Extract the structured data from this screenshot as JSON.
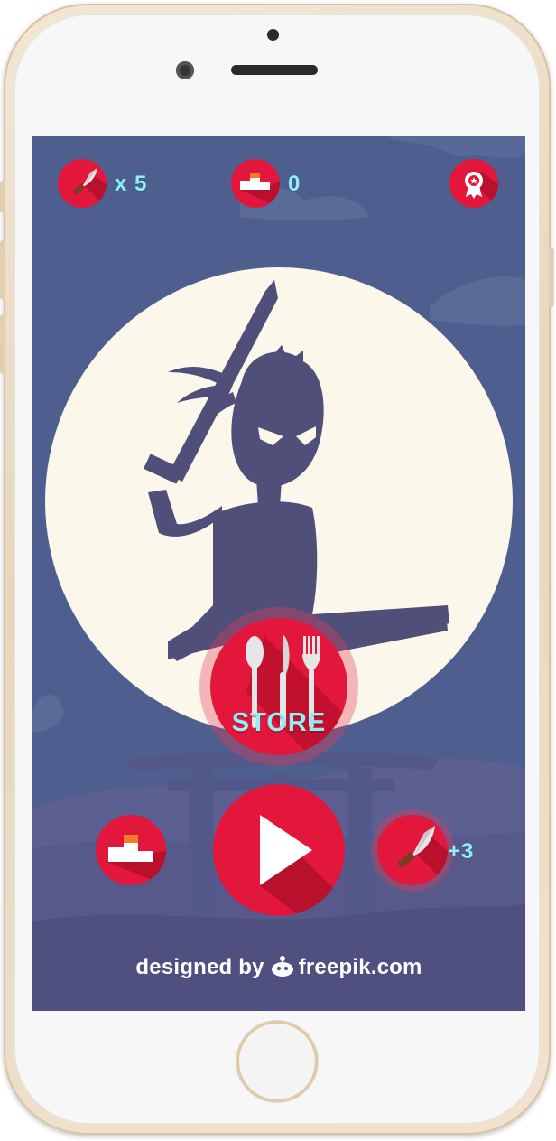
{
  "hud": {
    "knives_count": "x 5",
    "score": "0"
  },
  "buttons": {
    "store_label": "STORE",
    "knife_bonus": "+3"
  },
  "footer": {
    "designed_by": "designed by",
    "brand": "freepik.com"
  },
  "colors": {
    "accent_red": "#e3163b",
    "text_cyan": "#8ef0f5",
    "sky": "#4e5e8e",
    "moon": "#fbf7ea",
    "silhouette": "#4f4f7a"
  },
  "icons": {
    "knife": "knife-icon",
    "podium": "podium-icon",
    "award": "award-ribbon-icon",
    "cutlery": "cutlery-icon",
    "play": "play-icon"
  }
}
